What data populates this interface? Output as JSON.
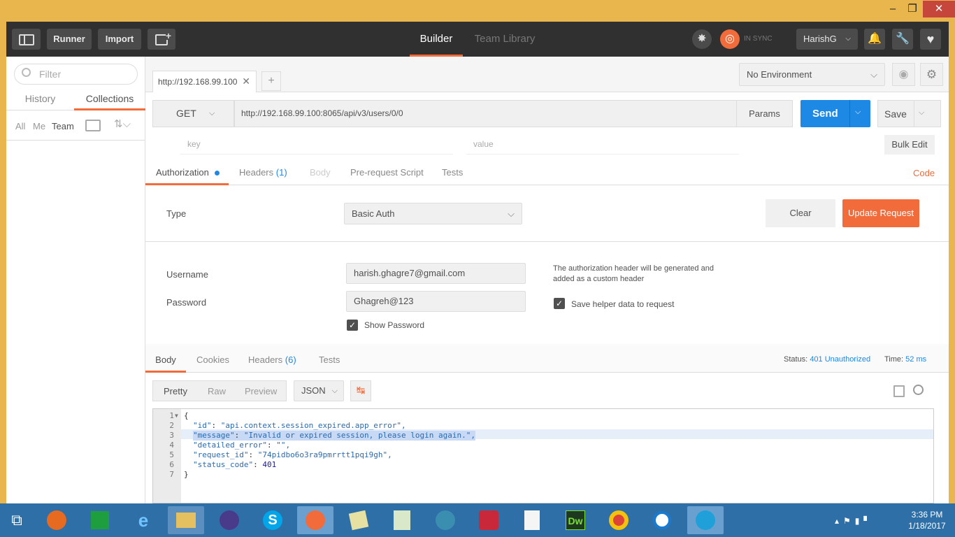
{
  "toolbar": {
    "runner": "Runner",
    "import": "Import",
    "builder": "Builder",
    "team_library": "Team Library",
    "sync": "IN SYNC",
    "user": "HarishG"
  },
  "sidebar": {
    "filter_placeholder": "Filter",
    "tabs": [
      "History",
      "Collections"
    ],
    "filters": [
      "All",
      "Me",
      "Team"
    ]
  },
  "request_tab": {
    "label": "http://192.168.99.100"
  },
  "environment": {
    "selected": "No Environment"
  },
  "request": {
    "method": "GET",
    "url": "http://192.168.99.100:8065/api/v3/users/0/0",
    "params": "Params",
    "send": "Send",
    "save": "Save",
    "key_placeholder": "key",
    "value_placeholder": "value",
    "bulk_edit": "Bulk Edit"
  },
  "req_tabs": {
    "authorization": "Authorization",
    "headers": "Headers",
    "headers_count": "(1)",
    "body": "Body",
    "prerequest": "Pre-request Script",
    "tests": "Tests",
    "code": "Code"
  },
  "auth": {
    "type_label": "Type",
    "type_value": "Basic Auth",
    "clear": "Clear",
    "update": "Update Request",
    "username_label": "Username",
    "username_value": "harish.ghagre7@gmail.com",
    "password_label": "Password",
    "password_value": "Ghagreh@123",
    "show_password": "Show Password",
    "helper_text": "The authorization header will be generated and added as a custom header",
    "save_helper": "Save helper data to request"
  },
  "response": {
    "tabs": [
      "Body",
      "Cookies",
      "Headers",
      "Tests"
    ],
    "headers_count": "(6)",
    "status_label": "Status:",
    "status_value": "401 Unauthorized",
    "time_label": "Time:",
    "time_value": "52 ms",
    "views": [
      "Pretty",
      "Raw",
      "Preview"
    ],
    "format": "JSON",
    "lines": [
      {
        "n": "1",
        "text": "{"
      },
      {
        "n": "2",
        "key": "\"id\"",
        "val": "\"api.context.session_expired.app_error\","
      },
      {
        "n": "3",
        "key": "\"message\"",
        "val": "\"Invalid or expired session, please login again.\","
      },
      {
        "n": "4",
        "key": "\"detailed_error\"",
        "val": "\"\","
      },
      {
        "n": "5",
        "key": "\"request_id\"",
        "val": "\"74pidbo6o3ra9pmrrtt1pqi9gh\","
      },
      {
        "n": "6",
        "key": "\"status_code\"",
        "val": "401"
      },
      {
        "n": "7",
        "text": "}"
      }
    ]
  },
  "taskbar": {
    "time": "3:36 PM",
    "date": "1/18/2017"
  }
}
